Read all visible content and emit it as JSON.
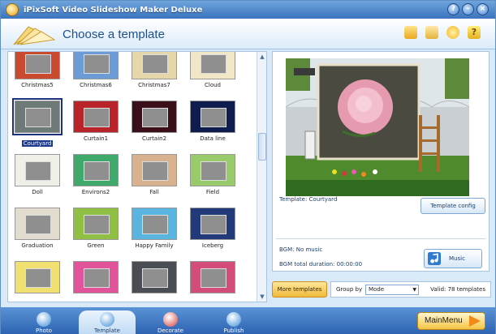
{
  "window": {
    "title": "iPixSoft Video Slideshow Maker Deluxe"
  },
  "header": {
    "title": "Choose a template"
  },
  "templates": [
    {
      "label": "Christmas5",
      "frame": "#c94a2f"
    },
    {
      "label": "Christmas6",
      "frame": "#6b9cd8"
    },
    {
      "label": "Christmas7",
      "frame": "#e7d6a8"
    },
    {
      "label": "Cloud",
      "frame": "#f1e6c5"
    },
    {
      "label": "Courtyard",
      "frame": "#6d7a78"
    },
    {
      "label": "Curtain1",
      "frame": "#b8242a"
    },
    {
      "label": "Curtain2",
      "frame": "#3b0f19"
    },
    {
      "label": "Data line",
      "frame": "#0e1d4e"
    },
    {
      "label": "Doll",
      "frame": "#f0f0e8"
    },
    {
      "label": "Environs2",
      "frame": "#3fa96b"
    },
    {
      "label": "Fall",
      "frame": "#d8b28e"
    },
    {
      "label": "Field",
      "frame": "#9acb6b"
    },
    {
      "label": "Graduation",
      "frame": "#e2dccf"
    },
    {
      "label": "Green",
      "frame": "#8fc044"
    },
    {
      "label": "Happy Family",
      "frame": "#59b4e0"
    },
    {
      "label": "Iceberg",
      "frame": "#233a7a"
    },
    {
      "label": "",
      "frame": "#f0e070"
    },
    {
      "label": "",
      "frame": "#e1539a"
    },
    {
      "label": "",
      "frame": "#4a4e54"
    },
    {
      "label": "",
      "frame": "#d24d7a"
    }
  ],
  "preview": {
    "template_name": "Template: Courtyard",
    "config_button": "Template config",
    "bgm": "BGM: No music",
    "bgm_duration": "BGM total duration: 00:00:00",
    "music_button": "Music"
  },
  "footer": {
    "more_templates": "More templates",
    "group_by_label": "Group by",
    "group_by_value": "Mode",
    "valid": "Valid: 78 templates"
  },
  "nav": {
    "tabs": [
      {
        "label": "Photo",
        "color": "#3c8dd8"
      },
      {
        "label": "Template",
        "color": "#3c8dd8"
      },
      {
        "label": "Decorate",
        "color": "#d94040"
      },
      {
        "label": "Publish",
        "color": "#3c8dd8"
      }
    ],
    "main_menu": "MainMenu"
  }
}
